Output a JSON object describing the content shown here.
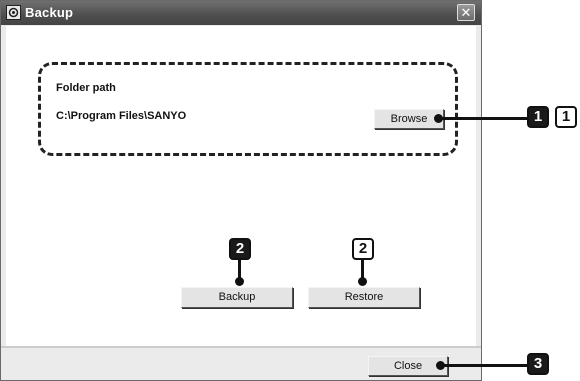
{
  "window": {
    "title": "Backup",
    "close_glyph": "✕"
  },
  "folder": {
    "label": "Folder path",
    "path": "C:\\Program Files\\SANYO"
  },
  "buttons": {
    "browse": "Browse",
    "backup": "Backup",
    "restore": "Restore",
    "close": "Close"
  },
  "callouts": {
    "browse_dark": "1",
    "browse_light": "1",
    "backup": "2",
    "restore": "2",
    "close": "3"
  },
  "icons": {
    "app": "backup-app-icon",
    "close": "close-icon"
  }
}
